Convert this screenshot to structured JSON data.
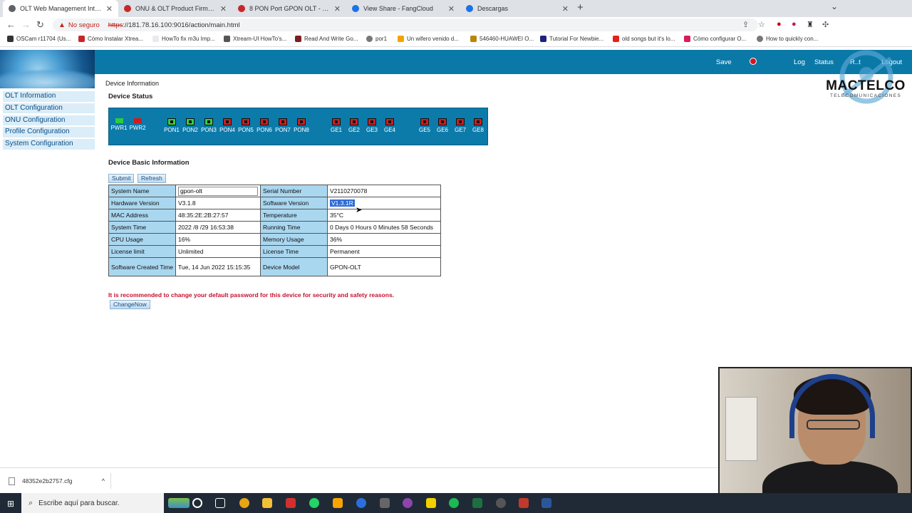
{
  "browser": {
    "tabs": [
      {
        "title": "OLT Web Management Interface",
        "active": true,
        "color": "#5f6368"
      },
      {
        "title": "ONU & OLT Product Firmware De",
        "active": false,
        "color": "#c62828"
      },
      {
        "title": "8 PON Port GPON OLT - Optical",
        "active": false,
        "color": "#c62828"
      },
      {
        "title": "View Share - FangCloud",
        "active": false,
        "color": "#1a73e8"
      },
      {
        "title": "Descargas",
        "active": false,
        "color": "#1a73e8"
      }
    ],
    "security_label": "No seguro",
    "url_scheme": "https",
    "url_rest": "://181.78.16.100:9016/action/main.html",
    "bookmarks": [
      "OSCam r11704 (Us...",
      "Cómo Instalar Xtrea...",
      "HowTo fix m3u Imp...",
      "Xtream-UI HowTo's...",
      "Read And Write Go...",
      "por1",
      "Un wifero venido d...",
      "546460-HUAWEI O...",
      "Tutorial For Newbie...",
      "old songs but it's lo...",
      "Cómo configurar O...",
      "How to quickly con..."
    ]
  },
  "header": {
    "save": "Save",
    "log": "Log",
    "status": "Status",
    "reboot": "R..t",
    "logout": "Logout"
  },
  "brand": {
    "name": "MACTELCO",
    "tagline": "TELECOMUNICACIONES"
  },
  "breadcrumb": "Device Information",
  "sidebar": {
    "items": [
      "OLT Information",
      "OLT Configuration",
      "ONU Configuration",
      "Profile Configuration",
      "System Configuration"
    ]
  },
  "device_status": {
    "title": "Device Status",
    "power": [
      {
        "label": "PWR1",
        "state": "green"
      },
      {
        "label": "PWR2",
        "state": "red"
      }
    ],
    "pon": [
      {
        "label": "PON1",
        "state": "green"
      },
      {
        "label": "PON2",
        "state": "green"
      },
      {
        "label": "PON3",
        "state": "green"
      },
      {
        "label": "PON4",
        "state": "red"
      },
      {
        "label": "PON5",
        "state": "red"
      },
      {
        "label": "PON6",
        "state": "red"
      },
      {
        "label": "PON7",
        "state": "red"
      },
      {
        "label": "PON8",
        "state": "red"
      }
    ],
    "ge_a": [
      {
        "label": "GE1",
        "state": "red"
      },
      {
        "label": "GE2",
        "state": "red"
      },
      {
        "label": "GE3",
        "state": "red"
      },
      {
        "label": "GE4",
        "state": "red"
      }
    ],
    "ge_b": [
      {
        "label": "GE5",
        "state": "red"
      },
      {
        "label": "GE6",
        "state": "red"
      },
      {
        "label": "GE7",
        "state": "red"
      },
      {
        "label": "GE8",
        "state": "red"
      }
    ]
  },
  "basic_info": {
    "title": "Device Basic Information",
    "submit": "Submit",
    "refresh": "Refresh",
    "system_name_label": "System Name",
    "system_name_value": "gpon-olt",
    "serial_label": "Serial Number",
    "serial_value": "V2110270078",
    "hw_label": "Hardware Version",
    "hw_value": "V3.1.8",
    "sw_label": "Software Version",
    "sw_value": "V1.3.1R",
    "mac_label": "MAC Address",
    "mac_value": "48:35:2E:2B:27:57",
    "temp_label": "Temperature",
    "temp_value": "35°C",
    "systime_label": "System Time",
    "systime_value": "2022 /8 /29 16:53:38",
    "runtime_label": "Running Time",
    "runtime_value": "0 Days 0 Hours 0 Minutes 58 Seconds",
    "cpu_label": "CPU Usage",
    "cpu_value": "16%",
    "mem_label": "Memory Usage",
    "mem_value": "36%",
    "license_limit_label": "License limit",
    "license_limit_value": "Unlimited",
    "license_time_label": "License Time",
    "license_time_value": "Permanent",
    "sw_created_label": "Software Created Time",
    "sw_created_value": "Tue, 14 Jun 2022 15:15:35",
    "model_label": "Device Model",
    "model_value": "GPON-OLT"
  },
  "warning": "It is recommended to change your default password for this device for security and safety reasons.",
  "change_now": "ChangeNow",
  "download": {
    "filename": "48352e2b2757.cfg"
  },
  "taskbar": {
    "search_placeholder": "Escribe aquí para buscar."
  }
}
